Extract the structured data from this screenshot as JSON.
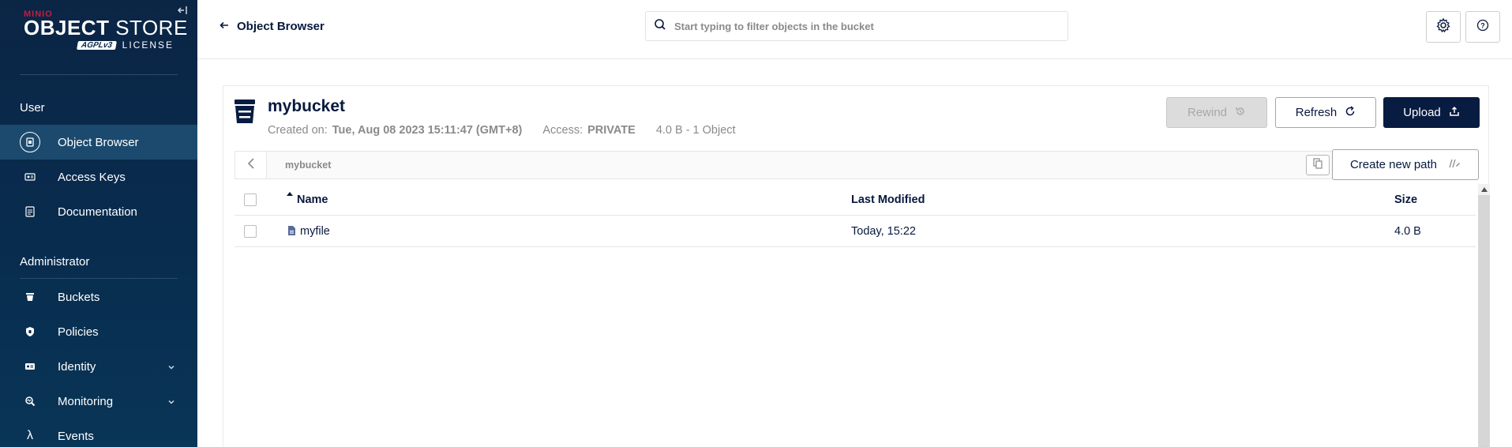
{
  "sidebar": {
    "logo": {
      "brand": "MINIO",
      "product_bold": "OBJECT",
      "product_thin": "STORE",
      "license_badge": "AGPLv3",
      "license_text": "LICENSE"
    },
    "sections": [
      {
        "label": "User",
        "items": [
          {
            "label": "Object Browser",
            "icon": "object-browser-icon",
            "active": true
          },
          {
            "label": "Access Keys",
            "icon": "access-keys-icon"
          },
          {
            "label": "Documentation",
            "icon": "documentation-icon"
          }
        ]
      },
      {
        "label": "Administrator",
        "items": [
          {
            "label": "Buckets",
            "icon": "buckets-icon"
          },
          {
            "label": "Policies",
            "icon": "policies-icon"
          },
          {
            "label": "Identity",
            "icon": "identity-icon",
            "expandable": true
          },
          {
            "label": "Monitoring",
            "icon": "monitoring-icon",
            "expandable": true
          },
          {
            "label": "Events",
            "icon": "lambda-icon"
          }
        ]
      }
    ]
  },
  "header": {
    "back_label": "Object Browser",
    "search_placeholder": "Start typing to filter objects in the bucket"
  },
  "bucket": {
    "name": "mybucket",
    "created_label": "Created on:",
    "created_value": "Tue, Aug 08 2023 15:11:47 (GMT+8)",
    "access_label": "Access:",
    "access_value": "PRIVATE",
    "summary": "4.0 B - 1 Object"
  },
  "actions": {
    "rewind": "Rewind",
    "refresh": "Refresh",
    "upload": "Upload",
    "create_path": "Create new path"
  },
  "path": {
    "current": "mybucket"
  },
  "table": {
    "columns": {
      "name": "Name",
      "modified": "Last Modified",
      "size": "Size"
    },
    "rows": [
      {
        "name": "myfile",
        "modified": "Today, 15:22",
        "size": "4.0 B"
      }
    ]
  },
  "colors": {
    "sidebar_bg": "#0b2545",
    "sidebar_active": "#1c4a6e",
    "primary": "#081c42",
    "brand_red": "#c51c3f"
  }
}
